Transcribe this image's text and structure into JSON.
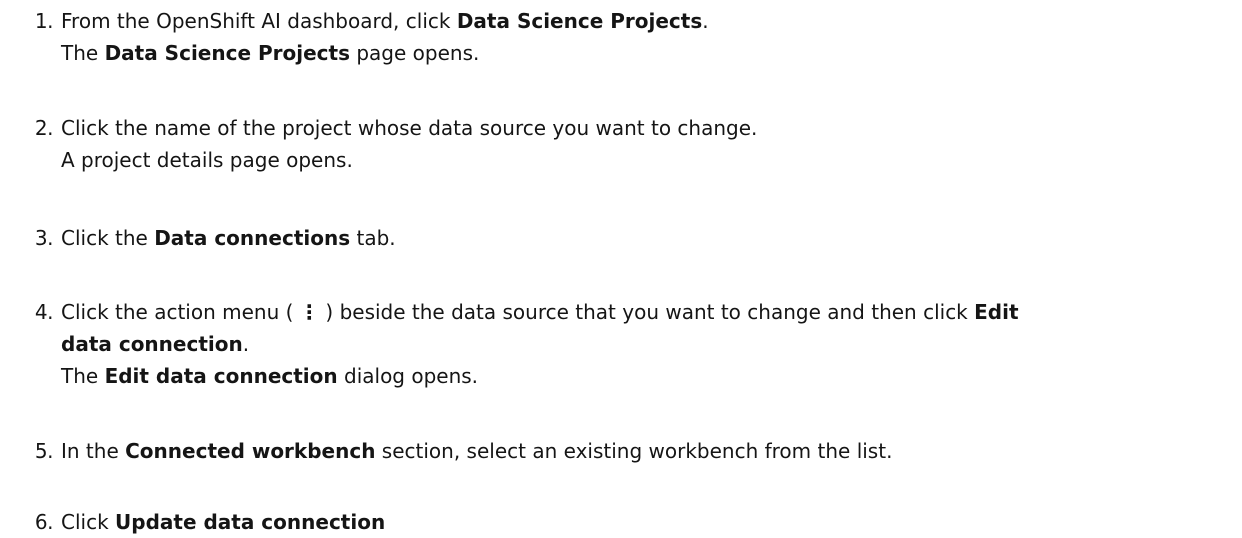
{
  "steps": [
    {
      "num": "1.",
      "line1_pre": "From the OpenShift AI dashboard, click ",
      "line1_bold": "Data Science Projects",
      "line1_post": ".",
      "line2_pre": "The ",
      "line2_bold": "Data Science Projects",
      "line2_post": " page opens."
    },
    {
      "num": "2.",
      "line1": "Click the name of the project whose data source you want to change.",
      "line2": "A project details page opens."
    },
    {
      "num": "3.",
      "pre": "Click the ",
      "bold": "Data connections",
      "post": " tab."
    },
    {
      "num": "4.",
      "pre": "Click the action menu (",
      "kebab_icon": "kebab-menu-icon",
      "kebab_glyph": "⋮",
      "mid": ") beside the data source that you want to change and then click ",
      "bold1": "Edit",
      "bold2": "data connection",
      "post": ".",
      "line3_pre": "The ",
      "line3_bold": "Edit data connection",
      "line3_post": " dialog opens."
    },
    {
      "num": "5.",
      "pre": "In the ",
      "bold": "Connected workbench",
      "post": " section, select an existing workbench from the list."
    },
    {
      "num": "6.",
      "pre": "Click ",
      "bold": "Update data connection"
    }
  ]
}
